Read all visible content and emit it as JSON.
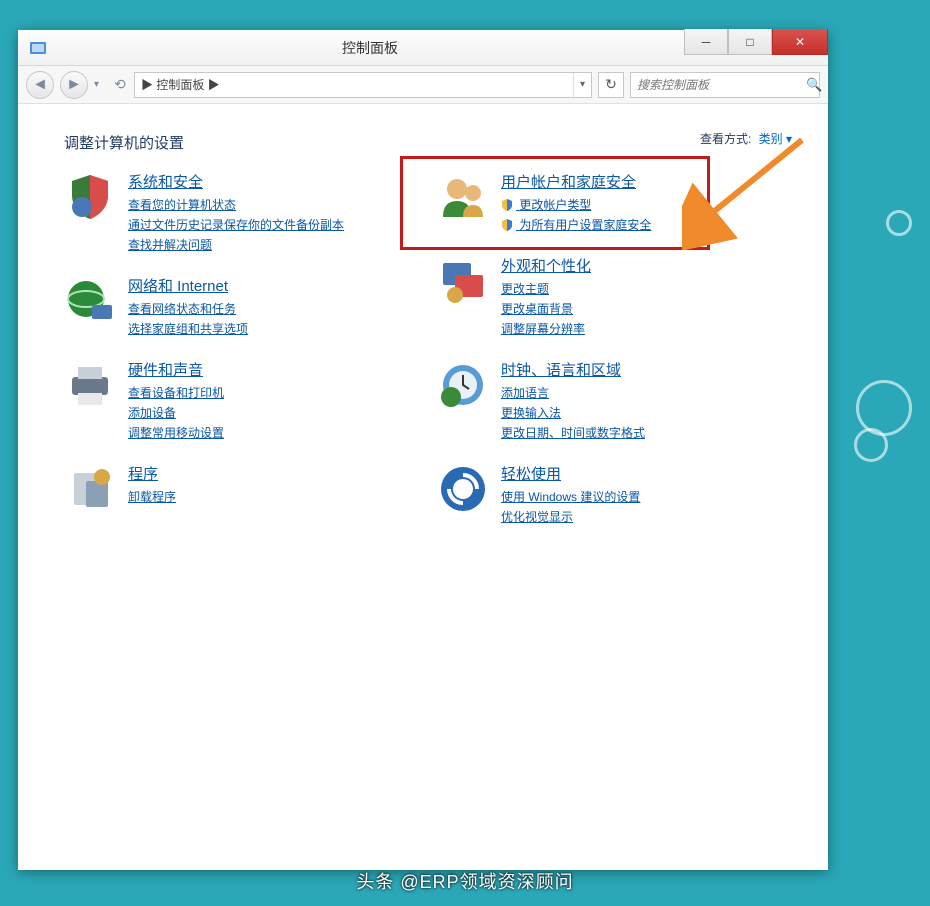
{
  "window": {
    "title": "控制面板",
    "min": "─",
    "max": "□",
    "close": "✕"
  },
  "nav": {
    "back": "◄",
    "fwd": "►",
    "drop": "▾",
    "up_icon": "⟲",
    "crumb_root": "▶ 控制面板 ▶",
    "addr_drop": "▾",
    "refresh": "↻",
    "search_placeholder": "搜索控制面板",
    "search_icon": "🔍"
  },
  "page": {
    "heading": "调整计算机的设置",
    "view_label": "查看方式:",
    "view_value": "类别 ▾"
  },
  "left": [
    {
      "title": "系统和安全",
      "links": [
        "查看您的计算机状态",
        "通过文件历史记录保存你的文件备份副本",
        "查找并解决问题"
      ]
    },
    {
      "title": "网络和 Internet",
      "links": [
        "查看网络状态和任务",
        "选择家庭组和共享选项"
      ]
    },
    {
      "title": "硬件和声音",
      "links": [
        "查看设备和打印机",
        "添加设备",
        "调整常用移动设置"
      ]
    },
    {
      "title": "程序",
      "links": [
        "卸载程序"
      ]
    }
  ],
  "right": [
    {
      "title": "用户帐户和家庭安全",
      "links": [
        "更改帐户类型",
        "为所有用户设置家庭安全"
      ],
      "shield": true
    },
    {
      "title": "外观和个性化",
      "links": [
        "更改主题",
        "更改桌面背景",
        "调整屏幕分辨率"
      ]
    },
    {
      "title": "时钟、语言和区域",
      "links": [
        "添加语言",
        "更换输入法",
        "更改日期、时间或数字格式"
      ]
    },
    {
      "title": "轻松使用",
      "links": [
        "使用 Windows 建议的设置",
        "优化视觉显示"
      ]
    }
  ],
  "watermark": "头条 @ERP领域资深顾问"
}
